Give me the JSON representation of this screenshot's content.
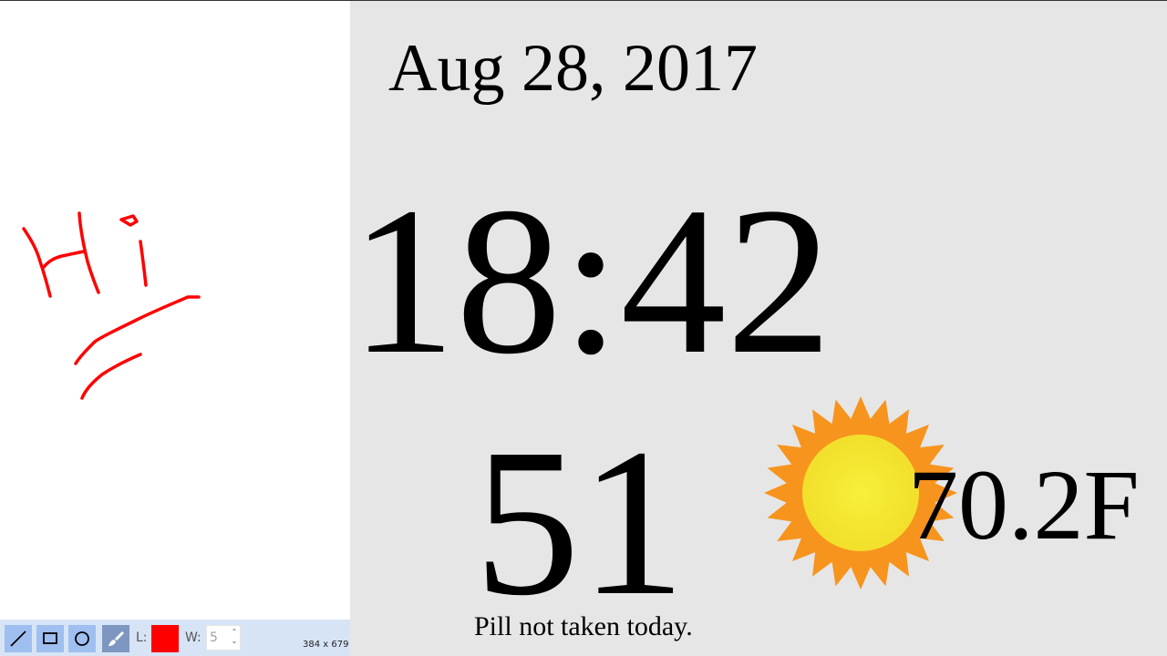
{
  "drawing": {
    "stroke_color": "#ff0000",
    "canvas_size_label": "384 x 679"
  },
  "toolbar": {
    "tools": [
      "line-tool",
      "rectangle-tool",
      "circle-tool",
      "brush-tool"
    ],
    "active_tool": "brush-tool",
    "line_color_label": "L:",
    "line_color": "#ff0000",
    "width_label": "W:",
    "width_value": "5"
  },
  "dashboard": {
    "date": "Aug 28, 2017",
    "time": "18:42",
    "counter": "51",
    "pill_status": "Pill not taken today.",
    "weather_icon": "sun-icon",
    "temperature": "70.2F"
  },
  "colors": {
    "dashboard_bg": "#e6e6e6",
    "toolbar_bg": "#d7e4f5",
    "sun_outer": "#f7941d",
    "sun_inner": "#f5ea2e"
  }
}
